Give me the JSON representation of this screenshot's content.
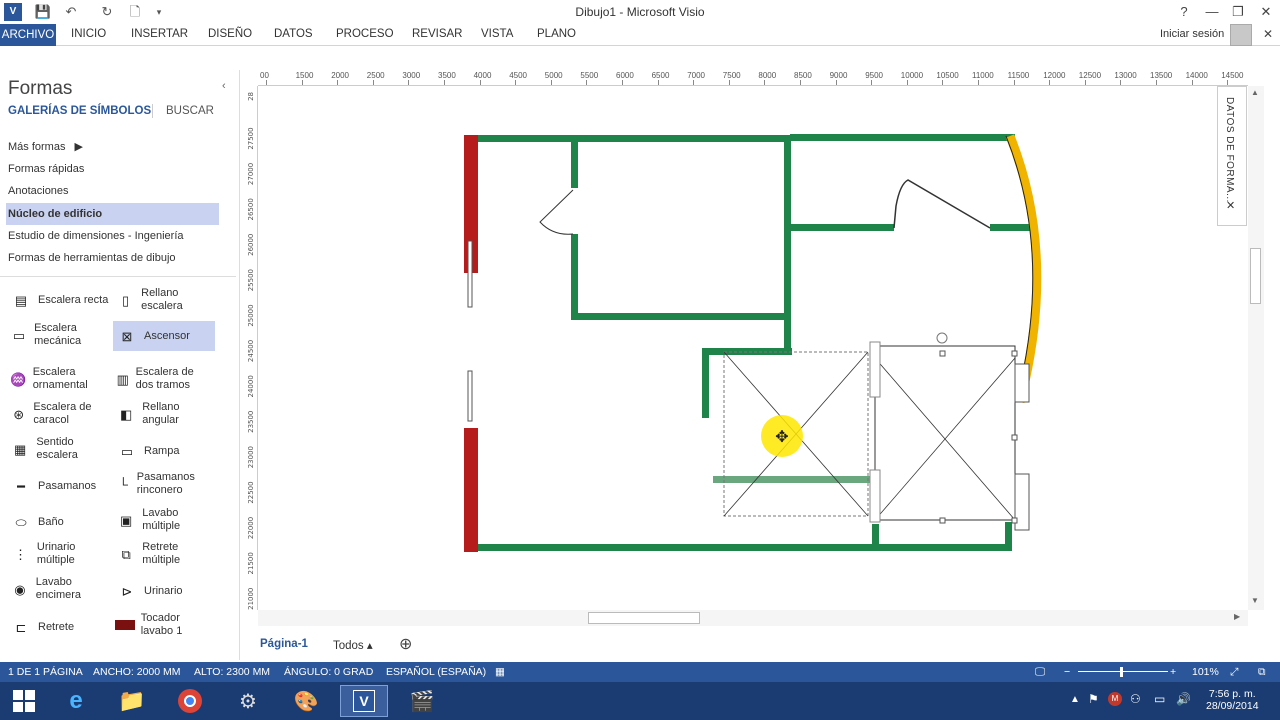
{
  "window": {
    "title": "Dibujo1 - Microsoft Visio",
    "help": "?",
    "qat_icons": [
      "save-icon",
      "undo-icon",
      "redo-icon",
      "new-doc-icon"
    ]
  },
  "ribbon": {
    "file_tab": "ARCHIVO",
    "tabs": [
      "INICIO",
      "INSERTAR",
      "DISEÑO",
      "DATOS",
      "PROCESO",
      "REVISAR",
      "VISTA",
      "PLANO"
    ],
    "signin": "Iniciar sesión"
  },
  "shapes_panel": {
    "title": "Formas",
    "nav_galleries": "GALERÍAS DE SÍMBOLOS",
    "nav_search": "BUSCAR",
    "stencils": [
      "Más formas",
      "Formas rápidas",
      "Anotaciones",
      "Núcleo de edificio",
      "Estudio de dimensiones - Ingeniería",
      "Formas de herramientas de dibujo"
    ],
    "selected_stencil": "Núcleo de edificio",
    "shapes": [
      [
        "Escalera recta",
        "Rellano escalera"
      ],
      [
        "Escalera mecánica",
        "Ascensor"
      ],
      [
        "Escalera ornamental",
        "Escalera de dos tramos"
      ],
      [
        "Escalera de caracol",
        "Rellano angular"
      ],
      [
        "Sentido escalera",
        "Rampa"
      ],
      [
        "Pasamanos",
        "Pasamanos rinconero"
      ],
      [
        "Baño",
        "Lavabo múltiple"
      ],
      [
        "Urinario múltiple",
        "Retrete múltiple"
      ],
      [
        "Lavabo encimera",
        "Urinario"
      ],
      [
        "Retrete",
        "Tocador lavabo 1"
      ]
    ],
    "selected_shape": "Ascensor"
  },
  "ruler": {
    "h_ticks": [
      "00",
      "1500",
      "2000",
      "2500",
      "3000",
      "3500",
      "4000",
      "4500",
      "5000",
      "5500",
      "6000",
      "6500",
      "7000",
      "7500",
      "8000",
      "8500",
      "9000",
      "9500",
      "10000",
      "10500",
      "11000",
      "11500",
      "12000",
      "12500",
      "13000",
      "13500",
      "14000",
      "14500"
    ],
    "v_ticks": [
      "28",
      "27500",
      "27000",
      "26500",
      "26000",
      "25500",
      "25000",
      "24500",
      "24000",
      "23500",
      "23000",
      "22500",
      "22000",
      "21500",
      "21000"
    ]
  },
  "side_panel": {
    "label": "DATOS DE FORMA...",
    "close": "✕"
  },
  "pages": {
    "active": "Página-1",
    "all": "Todos ▴",
    "add": "⊕"
  },
  "status": {
    "page": "1 DE 1 PÁGINA",
    "width": "ANCHO: 2000 MM",
    "height": "ALTO: 2300 MM",
    "angle": "ÁNGULO: 0 GRAD",
    "lang": "ESPAÑOL (ESPAÑA)",
    "zoom": "101%"
  },
  "taskbar": {
    "time": "7:56 p. m.",
    "date": "28/09/2014"
  },
  "colors": {
    "accent": "#2b579a",
    "wall_green": "#1e8449",
    "wall_red": "#b71c1c",
    "wall_yellow": "#f0b400"
  }
}
